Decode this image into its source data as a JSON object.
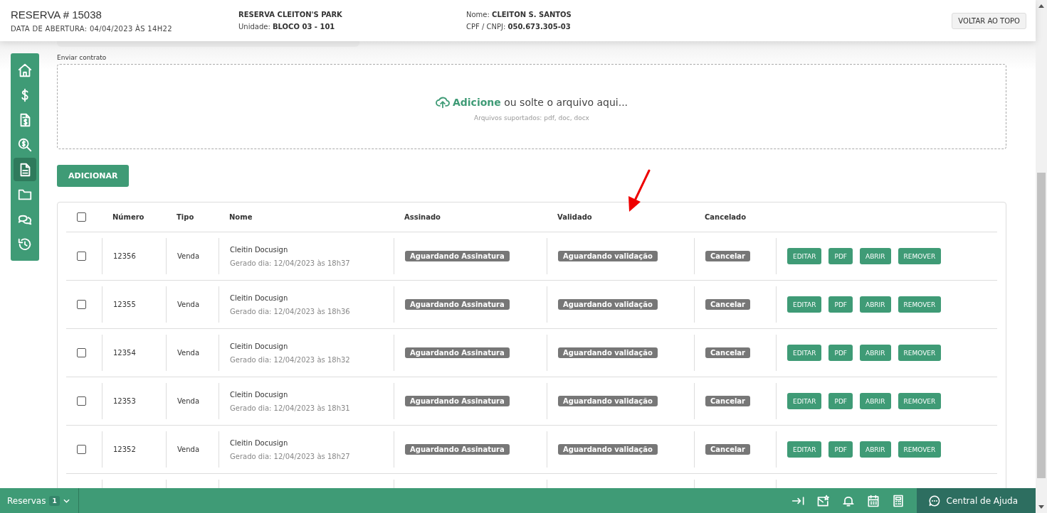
{
  "header": {
    "title": "RESERVA # 15038",
    "opened": "DATA DE ABERTURA: 04/04/2023 ÀS 14H22",
    "project": "RESERVA CLEITON'S PARK",
    "fields": [
      {
        "label": "Unidade:",
        "value": "BLOCO 03 - 101"
      },
      {
        "label": "Nome:",
        "value": "CLEITON S. SANTOS"
      },
      {
        "label": "CPF / CNPJ:",
        "value": "050.673.305-03"
      }
    ],
    "button": "VOLTAR AO TOPO"
  },
  "sidebar": {
    "items": [
      {
        "kind": "home",
        "selected": false
      },
      {
        "kind": "dollar",
        "selected": false
      },
      {
        "kind": "invoice",
        "selected": false
      },
      {
        "kind": "money-search",
        "selected": false
      },
      {
        "kind": "document",
        "selected": true
      },
      {
        "kind": "folder",
        "selected": false
      },
      {
        "kind": "chat",
        "selected": false
      },
      {
        "kind": "history",
        "selected": false
      }
    ]
  },
  "upload": {
    "label": "Enviar contrato",
    "link": "Adicione",
    "text": " ou solte o arquivo aqui...",
    "hint": "Arquivos suportados: pdf, doc, docx"
  },
  "add_button": "ADICIONAR",
  "table": {
    "header_checked": false,
    "columns": [
      "Número",
      "Tipo",
      "Nome",
      "Assinado",
      "Validado",
      "Cancelado"
    ],
    "rows": [
      {
        "checked": false,
        "number": "12356",
        "type": "Venda",
        "name": "Cleitin Docusign",
        "generated": "Gerado dia: 12/04/2023 às 18h37",
        "signed": "Aguardando Assinatura",
        "validated": "Aguardando validação",
        "cancel": "Cancelar",
        "actions": [
          "EDITAR",
          "PDF",
          "ABRIR",
          "REMOVER"
        ]
      },
      {
        "checked": false,
        "number": "12355",
        "type": "Venda",
        "name": "Cleitin Docusign",
        "generated": "Gerado dia: 12/04/2023 às 18h36",
        "signed": "Aguardando Assinatura",
        "validated": "Aguardando validação",
        "cancel": "Cancelar",
        "actions": [
          "EDITAR",
          "PDF",
          "ABRIR",
          "REMOVER"
        ]
      },
      {
        "checked": false,
        "number": "12354",
        "type": "Venda",
        "name": "Cleitin Docusign",
        "generated": "Gerado dia: 12/04/2023 às 18h32",
        "signed": "Aguardando Assinatura",
        "validated": "Aguardando validação",
        "cancel": "Cancelar",
        "actions": [
          "EDITAR",
          "PDF",
          "ABRIR",
          "REMOVER"
        ]
      },
      {
        "checked": false,
        "number": "12353",
        "type": "Venda",
        "name": "Cleitin Docusign",
        "generated": "Gerado dia: 12/04/2023 às 18h31",
        "signed": "Aguardando Assinatura",
        "validated": "Aguardando validação",
        "cancel": "Cancelar",
        "actions": [
          "EDITAR",
          "PDF",
          "ABRIR",
          "REMOVER"
        ]
      },
      {
        "checked": false,
        "number": "12352",
        "type": "Venda",
        "name": "Cleitin Docusign",
        "generated": "Gerado dia: 12/04/2023 às 18h27",
        "signed": "Aguardando Assinatura",
        "validated": "Aguardando validação",
        "cancel": "Cancelar",
        "actions": [
          "EDITAR",
          "PDF",
          "ABRIR",
          "REMOVER"
        ]
      }
    ]
  },
  "bottom_bar": {
    "tab": "Reservas",
    "count": "1",
    "tools": [
      {
        "kind": "collapse"
      },
      {
        "kind": "mail-star"
      },
      {
        "kind": "bell"
      },
      {
        "kind": "calendar"
      },
      {
        "kind": "calculator"
      }
    ],
    "help": "Central de Ajuda"
  }
}
